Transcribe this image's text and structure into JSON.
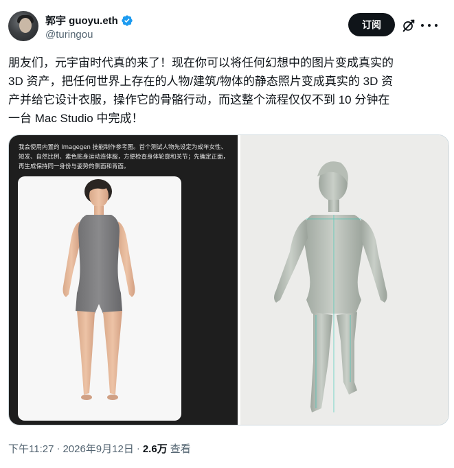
{
  "author": {
    "display_name": "郭宇 guoyu.eth",
    "handle": "@turingou",
    "verified": true
  },
  "actions": {
    "follow_label": "订阅",
    "grok_icon": "grok-icon",
    "more_icon": "more-icon"
  },
  "tweet": {
    "text": "朋友们，元宇宙时代真的来了！现在你可以将任何幻想中的图片变成真实的\n3D 资产，把任何世界上存在的人物/建筑/物体的静态照片变成真实的 3D 资\n产并给它设计衣服，操作它的骨骼行动，而这整个流程仅仅不到 10 分钟在\n一台 Mac Studio 中完成！"
  },
  "media": {
    "caption": "我会使用内置的 Imagegen 技能制作参考图。首个测试人物先设定为成年女性、短发、自然比例、素色贴身运动连体服，方便检查身体轮廓和关节；先确定正面，再生成保持同一身份与姿势的侧面和背面。"
  },
  "meta": {
    "time": "下午11:27",
    "separator": "·",
    "date": "2026年9月12日",
    "views_count": "2.6万",
    "views_label": "查看"
  },
  "colors": {
    "text_primary": "#0f1419",
    "text_secondary": "#536471",
    "verified_blue": "#1d9bf0",
    "media_dark": "#1e1e1e",
    "media_light": "#ececea"
  }
}
